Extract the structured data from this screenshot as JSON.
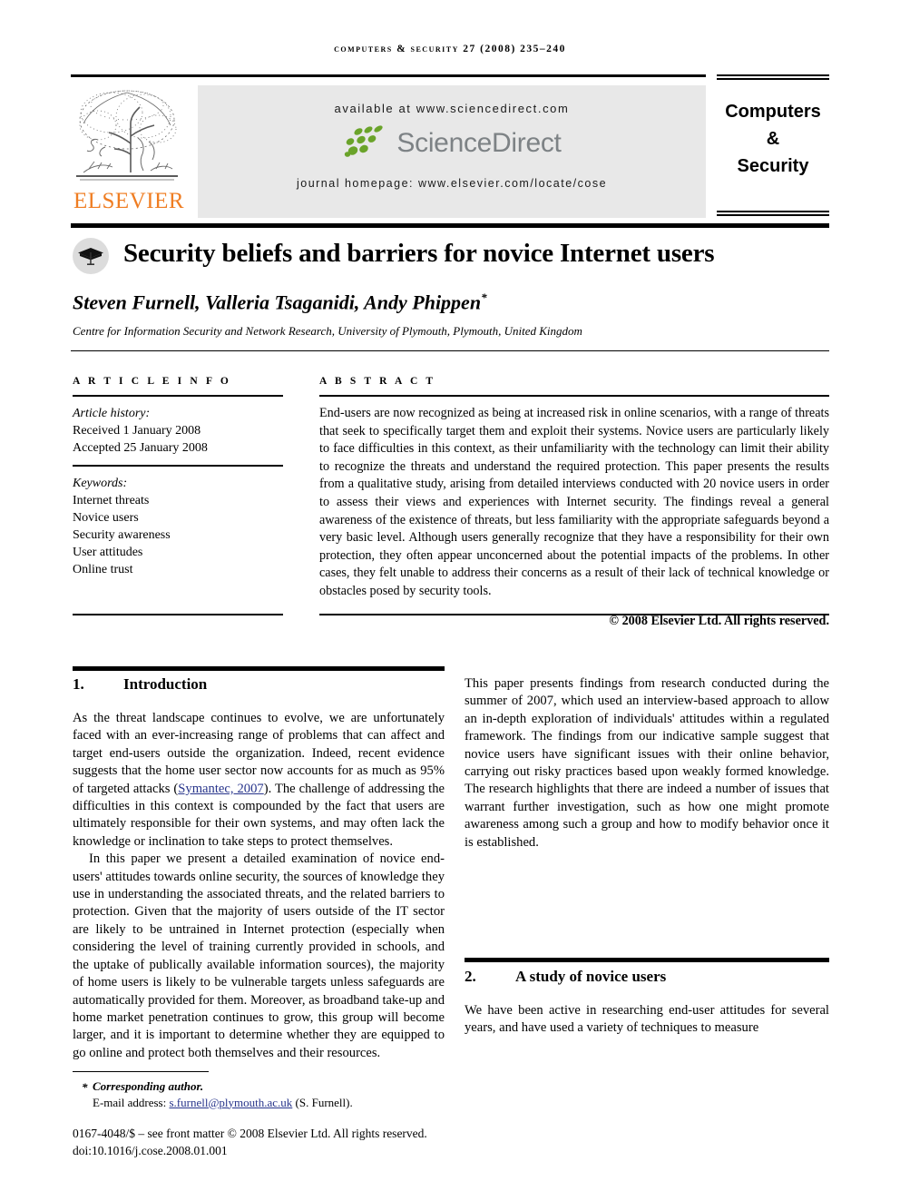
{
  "running_head": "COMPUTERS & SECURITY 27 (2008) 235–240",
  "masthead": {
    "available_at": "available at www.sciencedirect.com",
    "sciencedirect_wordmark": "ScienceDirect",
    "journal_homepage": "journal homepage: www.elsevier.com/locate/cose",
    "publisher_wordmark": "ELSEVIER",
    "publisher_color": "#ef7d22",
    "sciencedirect_leaf_color": "#6aa32a",
    "sciencedirect_word_color": "#7d8285",
    "journal_title_lines": [
      "Computers",
      "&",
      "Security"
    ]
  },
  "article": {
    "title": "Security beliefs and barriers for novice Internet users",
    "authors": "Steven Furnell, Valleria Tsaganidi, Andy Phippen",
    "corresponding_marker": "*",
    "affiliation": "Centre for Information Security and Network Research, University of Plymouth, Plymouth, United Kingdom"
  },
  "article_info": {
    "heading": "A R T I C L E   I N F O",
    "history_label": "Article history:",
    "history": [
      "Received 1 January 2008",
      "Accepted 25 January 2008"
    ],
    "keywords_label": "Keywords:",
    "keywords": [
      "Internet threats",
      "Novice users",
      "Security awareness",
      "User attitudes",
      "Online trust"
    ]
  },
  "abstract": {
    "heading": "A B S T R A C T",
    "text": "End-users are now recognized as being at increased risk in online scenarios, with a range of threats that seek to specifically target them and exploit their systems. Novice users are particularly likely to face difficulties in this context, as their unfamiliarity with the technology can limit their ability to recognize the threats and understand the required protection. This paper presents the results from a qualitative study, arising from detailed interviews conducted with 20 novice users in order to assess their views and experiences with Internet security. The findings reveal a general awareness of the existence of threats, but less familiarity with the appropriate safeguards beyond a very basic level. Although users generally recognize that they have a responsibility for their own protection, they often appear unconcerned about the potential impacts of the problems. In other cases, they felt unable to address their concerns as a result of their lack of technical knowledge or obstacles posed by security tools.",
    "copyright": "© 2008 Elsevier Ltd. All rights reserved."
  },
  "sections": {
    "intro": {
      "number": "1.",
      "title": "Introduction",
      "p1_before_cite": "As the threat landscape continues to evolve, we are unfortunately faced with an ever-increasing range of problems that can affect and target end-users outside the organization. Indeed, recent evidence suggests that the home user sector now accounts for as much as 95% of targeted attacks (",
      "p1_cite": "Symantec, 2007",
      "p1_after_cite": "). The challenge of addressing the difficulties in this context is compounded by the fact that users are ultimately responsible for their own systems, and may often lack the knowledge or inclination to take steps to protect themselves.",
      "p2": "In this paper we present a detailed examination of novice end-users' attitudes towards online security, the sources of knowledge they use in understanding the associated threats, and the related barriers to protection. Given that the majority of users outside of the IT sector are likely to be untrained in Internet protection (especially when considering the level of training currently provided in schools, and the uptake of publically available information sources), the majority of home users is likely to be vulnerable targets unless safeguards are automatically provided for them. Moreover, as broadband take-up and home market penetration continues to grow, this group will become larger, and it is important to determine whether they are equipped to go online and protect both themselves and their resources.",
      "p3": "This paper presents findings from research conducted during the summer of 2007, which used an interview-based approach to allow an in-depth exploration of individuals' attitudes within a regulated framework. The findings from our indicative sample suggest that novice users have significant issues with their online behavior, carrying out risky practices based upon weakly formed knowledge. The research highlights that there are indeed a number of issues that warrant further investigation, such as how one might promote awareness among such a group and how to modify behavior once it is established."
    },
    "study": {
      "number": "2.",
      "title": "A study of novice users",
      "p1": "We have been active in researching end-user attitudes for several years, and have used a variety of techniques to measure"
    }
  },
  "footer": {
    "corresponding": "Corresponding author.",
    "corresponding_star": "*",
    "email_label": "E-mail address:",
    "email_address": "s.furnell@plymouth.ac.uk",
    "email_owner": "(S. Furnell).",
    "imprint": "0167-4048/$ – see front matter © 2008 Elsevier Ltd. All rights reserved.",
    "doi": "doi:10.1016/j.cose.2008.01.001",
    "link_color": "#27348b"
  }
}
